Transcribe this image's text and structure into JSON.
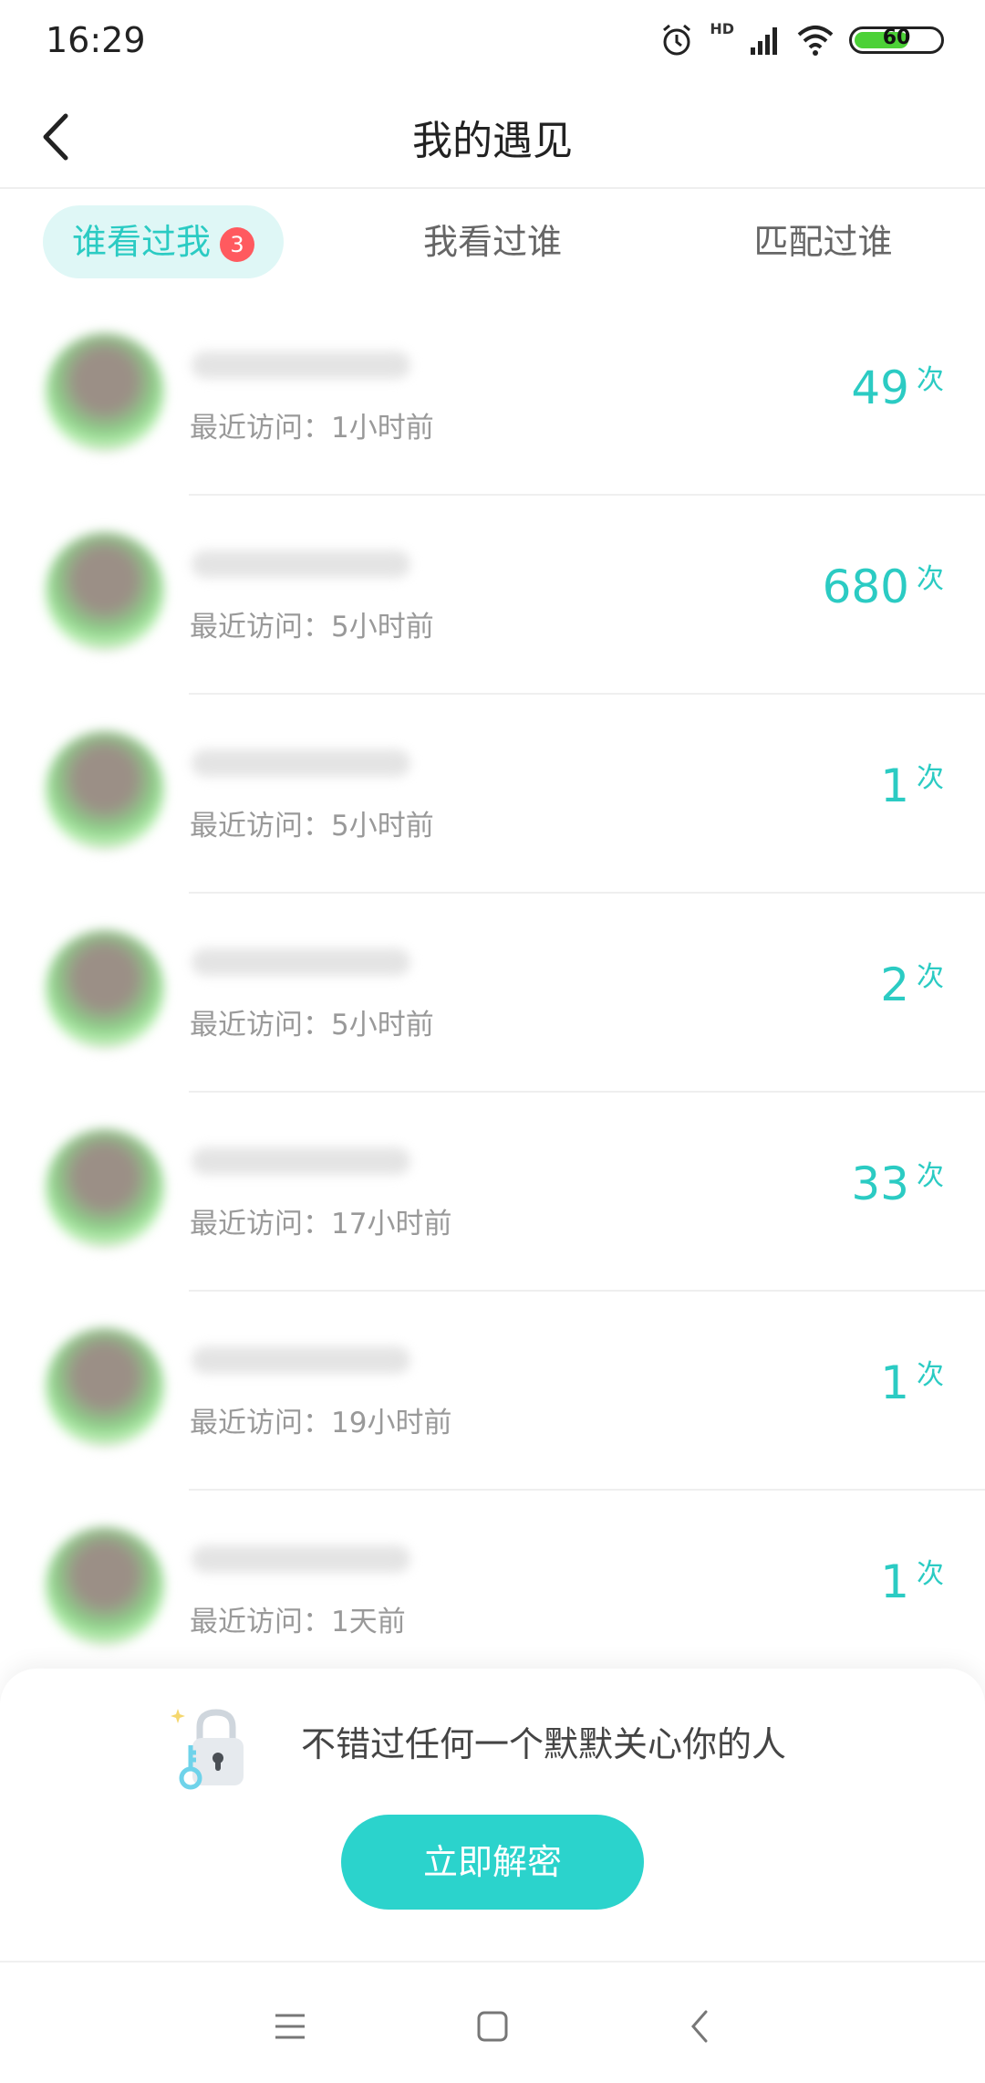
{
  "status_bar": {
    "time": "16:29",
    "battery": "60",
    "network": "HD"
  },
  "header": {
    "title": "我的遇见"
  },
  "tabs": [
    {
      "label": "谁看过我",
      "badge": "3",
      "active": true
    },
    {
      "label": "我看过谁",
      "active": false
    },
    {
      "label": "匹配过谁",
      "active": false
    }
  ],
  "visitors": [
    {
      "last_visit": "最近访问：1小时前",
      "count": "49",
      "unit": "次"
    },
    {
      "last_visit": "最近访问：5小时前",
      "count": "680",
      "unit": "次"
    },
    {
      "last_visit": "最近访问：5小时前",
      "count": "1",
      "unit": "次"
    },
    {
      "last_visit": "最近访问：5小时前",
      "count": "2",
      "unit": "次"
    },
    {
      "last_visit": "最近访问：17小时前",
      "count": "33",
      "unit": "次"
    },
    {
      "last_visit": "最近访问：19小时前",
      "count": "1",
      "unit": "次"
    },
    {
      "last_visit": "最近访问：1天前",
      "count": "1",
      "unit": "次"
    }
  ],
  "unlock_card": {
    "message": "不错过任何一个默默关心你的人",
    "button_label": "立即解密"
  },
  "colors": {
    "accent": "#2bcbc3",
    "badge": "#ff5a5f",
    "tab_active_bg": "#dff7f6"
  }
}
